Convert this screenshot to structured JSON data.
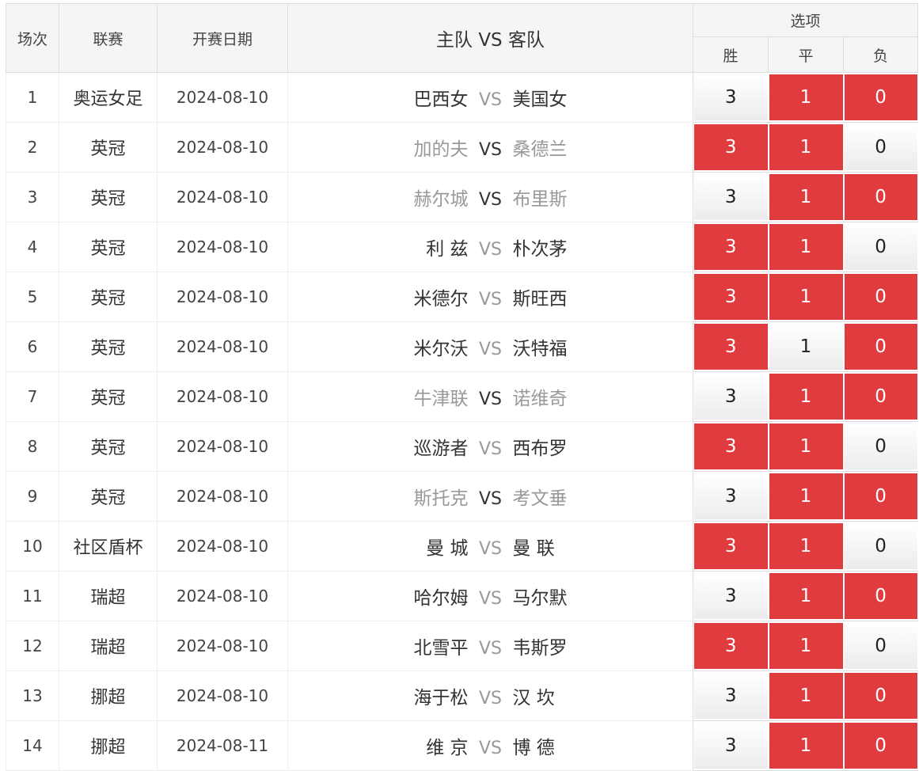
{
  "header": {
    "col_no": "场次",
    "col_league": "联赛",
    "col_date": "开赛日期",
    "col_match": "主队 VS 客队",
    "col_options": "选项",
    "opt_win": "胜",
    "opt_draw": "平",
    "opt_lose": "负"
  },
  "colors": {
    "selected": "#e03b3e",
    "unselected": "#f2f2f2",
    "dim_text": "#999999"
  },
  "rows": [
    {
      "no": "1",
      "league": "奥运女足",
      "date": "2024-08-10",
      "home": "巴西女",
      "vs": "VS",
      "away": "美国女",
      "dim": false,
      "win": "3",
      "draw": "1",
      "lose": "0",
      "win_on": false,
      "draw_on": true,
      "lose_on": true
    },
    {
      "no": "2",
      "league": "英冠",
      "date": "2024-08-10",
      "home": "加的夫",
      "vs": "VS",
      "away": "桑德兰",
      "dim": true,
      "win": "3",
      "draw": "1",
      "lose": "0",
      "win_on": true,
      "draw_on": true,
      "lose_on": false
    },
    {
      "no": "3",
      "league": "英冠",
      "date": "2024-08-10",
      "home": "赫尔城",
      "vs": "VS",
      "away": "布里斯",
      "dim": true,
      "win": "3",
      "draw": "1",
      "lose": "0",
      "win_on": false,
      "draw_on": true,
      "lose_on": true
    },
    {
      "no": "4",
      "league": "英冠",
      "date": "2024-08-10",
      "home": "利 兹",
      "vs": "VS",
      "away": "朴次茅",
      "dim": false,
      "win": "3",
      "draw": "1",
      "lose": "0",
      "win_on": true,
      "draw_on": true,
      "lose_on": false
    },
    {
      "no": "5",
      "league": "英冠",
      "date": "2024-08-10",
      "home": "米德尔",
      "vs": "VS",
      "away": "斯旺西",
      "dim": false,
      "win": "3",
      "draw": "1",
      "lose": "0",
      "win_on": true,
      "draw_on": true,
      "lose_on": true
    },
    {
      "no": "6",
      "league": "英冠",
      "date": "2024-08-10",
      "home": "米尔沃",
      "vs": "VS",
      "away": "沃特福",
      "dim": false,
      "win": "3",
      "draw": "1",
      "lose": "0",
      "win_on": true,
      "draw_on": false,
      "lose_on": true
    },
    {
      "no": "7",
      "league": "英冠",
      "date": "2024-08-10",
      "home": "牛津联",
      "vs": "VS",
      "away": "诺维奇",
      "dim": true,
      "win": "3",
      "draw": "1",
      "lose": "0",
      "win_on": false,
      "draw_on": true,
      "lose_on": true
    },
    {
      "no": "8",
      "league": "英冠",
      "date": "2024-08-10",
      "home": "巡游者",
      "vs": "VS",
      "away": "西布罗",
      "dim": false,
      "win": "3",
      "draw": "1",
      "lose": "0",
      "win_on": true,
      "draw_on": true,
      "lose_on": false
    },
    {
      "no": "9",
      "league": "英冠",
      "date": "2024-08-10",
      "home": "斯托克",
      "vs": "VS",
      "away": "考文垂",
      "dim": true,
      "win": "3",
      "draw": "1",
      "lose": "0",
      "win_on": false,
      "draw_on": true,
      "lose_on": true
    },
    {
      "no": "10",
      "league": "社区盾杯",
      "date": "2024-08-10",
      "home": "曼 城",
      "vs": "VS",
      "away": "曼 联",
      "dim": false,
      "win": "3",
      "draw": "1",
      "lose": "0",
      "win_on": true,
      "draw_on": true,
      "lose_on": false
    },
    {
      "no": "11",
      "league": "瑞超",
      "date": "2024-08-10",
      "home": "哈尔姆",
      "vs": "VS",
      "away": "马尔默",
      "dim": false,
      "win": "3",
      "draw": "1",
      "lose": "0",
      "win_on": false,
      "draw_on": true,
      "lose_on": true
    },
    {
      "no": "12",
      "league": "瑞超",
      "date": "2024-08-10",
      "home": "北雪平",
      "vs": "VS",
      "away": "韦斯罗",
      "dim": false,
      "win": "3",
      "draw": "1",
      "lose": "0",
      "win_on": true,
      "draw_on": true,
      "lose_on": false
    },
    {
      "no": "13",
      "league": "挪超",
      "date": "2024-08-10",
      "home": "海于松",
      "vs": "VS",
      "away": "汉 坎",
      "dim": false,
      "win": "3",
      "draw": "1",
      "lose": "0",
      "win_on": false,
      "draw_on": true,
      "lose_on": true
    },
    {
      "no": "14",
      "league": "挪超",
      "date": "2024-08-11",
      "home": "维 京",
      "vs": "VS",
      "away": "博 德",
      "dim": false,
      "win": "3",
      "draw": "1",
      "lose": "0",
      "win_on": false,
      "draw_on": true,
      "lose_on": true
    }
  ]
}
